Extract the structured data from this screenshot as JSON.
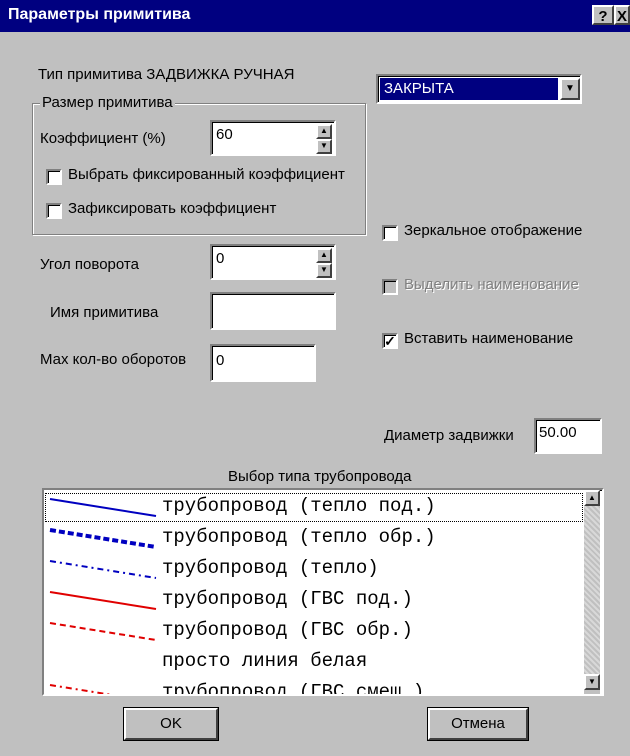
{
  "window": {
    "title": "Параметры примитива",
    "help_label": "?",
    "close_label": "X"
  },
  "primitive_type_label": "Тип примитива ЗАДВИЖКА РУЧНАЯ",
  "state_dropdown": {
    "value": "ЗАКРЫТА"
  },
  "size_group": {
    "title": "Размер примитива",
    "coefficient_label": "Коэффициент (%)",
    "coefficient_value": "60",
    "fixed_coef_label": "Выбрать фиксированный коэффициент",
    "fix_coef_label": "Зафиксировать коэффициент"
  },
  "mirror_label": "Зеркальное отображение",
  "highlight_name_label": "Выделить наименование",
  "insert_name_label": "Вставить наименование",
  "rotation": {
    "label": "Угол поворота",
    "value": "0"
  },
  "name": {
    "label": "Имя примитива",
    "value": ""
  },
  "max_turns": {
    "label": "Мах кол-во оборотов",
    "value": "0"
  },
  "diameter": {
    "label": "Диаметр задвижки",
    "value": "50.00"
  },
  "pipe_list": {
    "title": "Выбор типа трубопровода",
    "items": [
      {
        "label": "трубопровод (тепло под.)",
        "color": "#0000c0",
        "style": "solid"
      },
      {
        "label": "трубопровод (тепло обр.)",
        "color": "#0000c0",
        "style": "dashed-thick"
      },
      {
        "label": "трубопровод (тепло)",
        "color": "#0000c0",
        "style": "dash-dot"
      },
      {
        "label": "трубопровод (ГВС под.)",
        "color": "#e00000",
        "style": "solid"
      },
      {
        "label": "трубопровод (ГВС обр.)",
        "color": "#e00000",
        "style": "dashed"
      },
      {
        "label": "просто линия белая",
        "color": "#ffffff",
        "style": "solid"
      },
      {
        "label": "трубопровод (ГВС смеш.)",
        "color": "#e00000",
        "style": "dash-dot"
      }
    ]
  },
  "buttons": {
    "ok": "OK",
    "cancel": "Отмена"
  }
}
